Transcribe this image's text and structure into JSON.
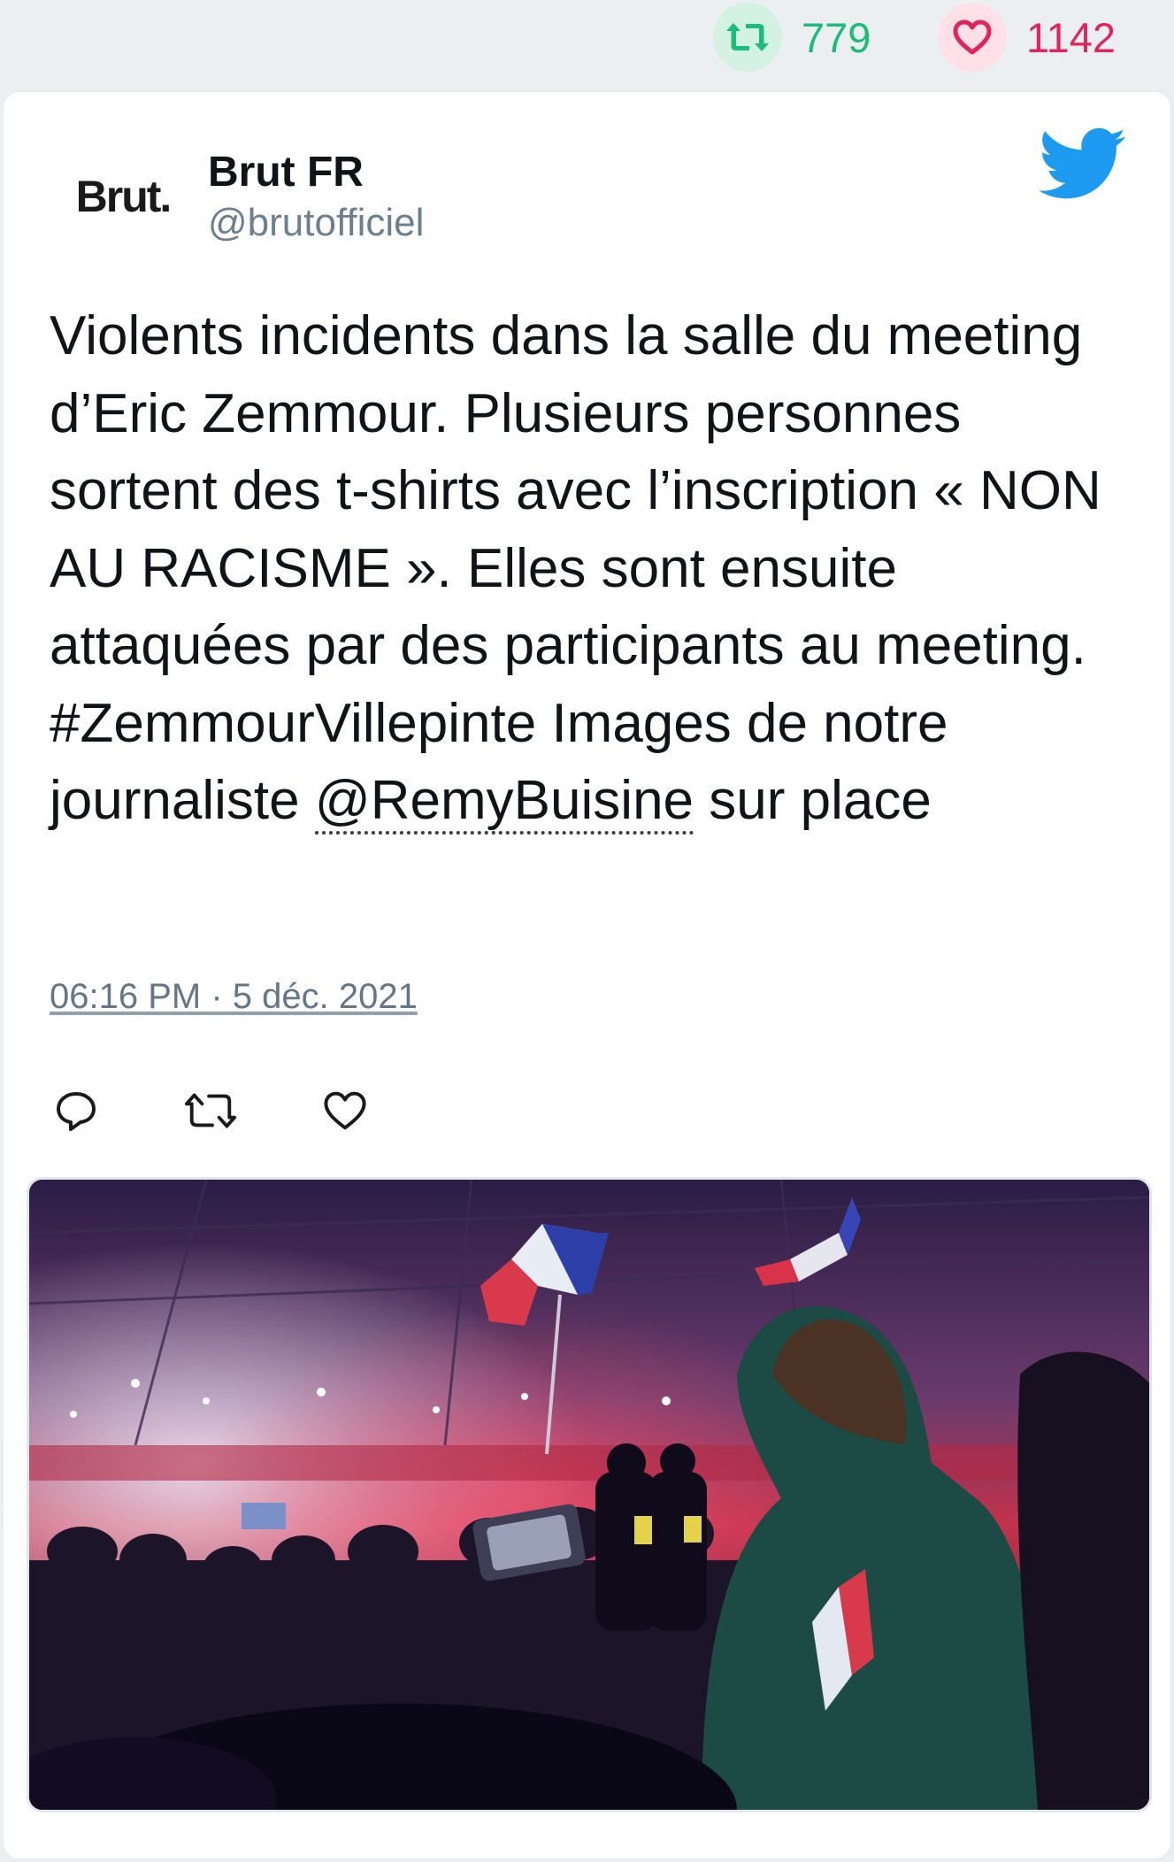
{
  "stats": {
    "retweets": "779",
    "likes": "1142",
    "retweet_icon": "retweet-icon",
    "like_icon": "heart-icon",
    "retweet_color": "#1cbc7a",
    "like_color": "#e0245e"
  },
  "tweet": {
    "author": {
      "avatar_text": "Brut.",
      "display_name": "Brut FR",
      "handle": "@brutofficiel"
    },
    "text_segments": {
      "body": "Violents incidents dans la salle du meeting d’Eric Zemmour. Plusieurs personnes sortent des t-shirts avec l’inscription « NON AU RACISME ». Elles sont ensuite attaquées par des participants au meeting. #ZemmourVillepinte Images de notre journaliste",
      "mention": "@RemyBuisine",
      "tail": "sur place"
    },
    "timestamp": "06:16 PM · 5 déc. 2021",
    "actions": {
      "reply_icon": "reply-icon",
      "retweet_icon": "retweet-icon",
      "like_icon": "heart-icon"
    },
    "media": {
      "type": "photo",
      "icon": "media-photo"
    },
    "brand_color": "#1d9bf0"
  }
}
